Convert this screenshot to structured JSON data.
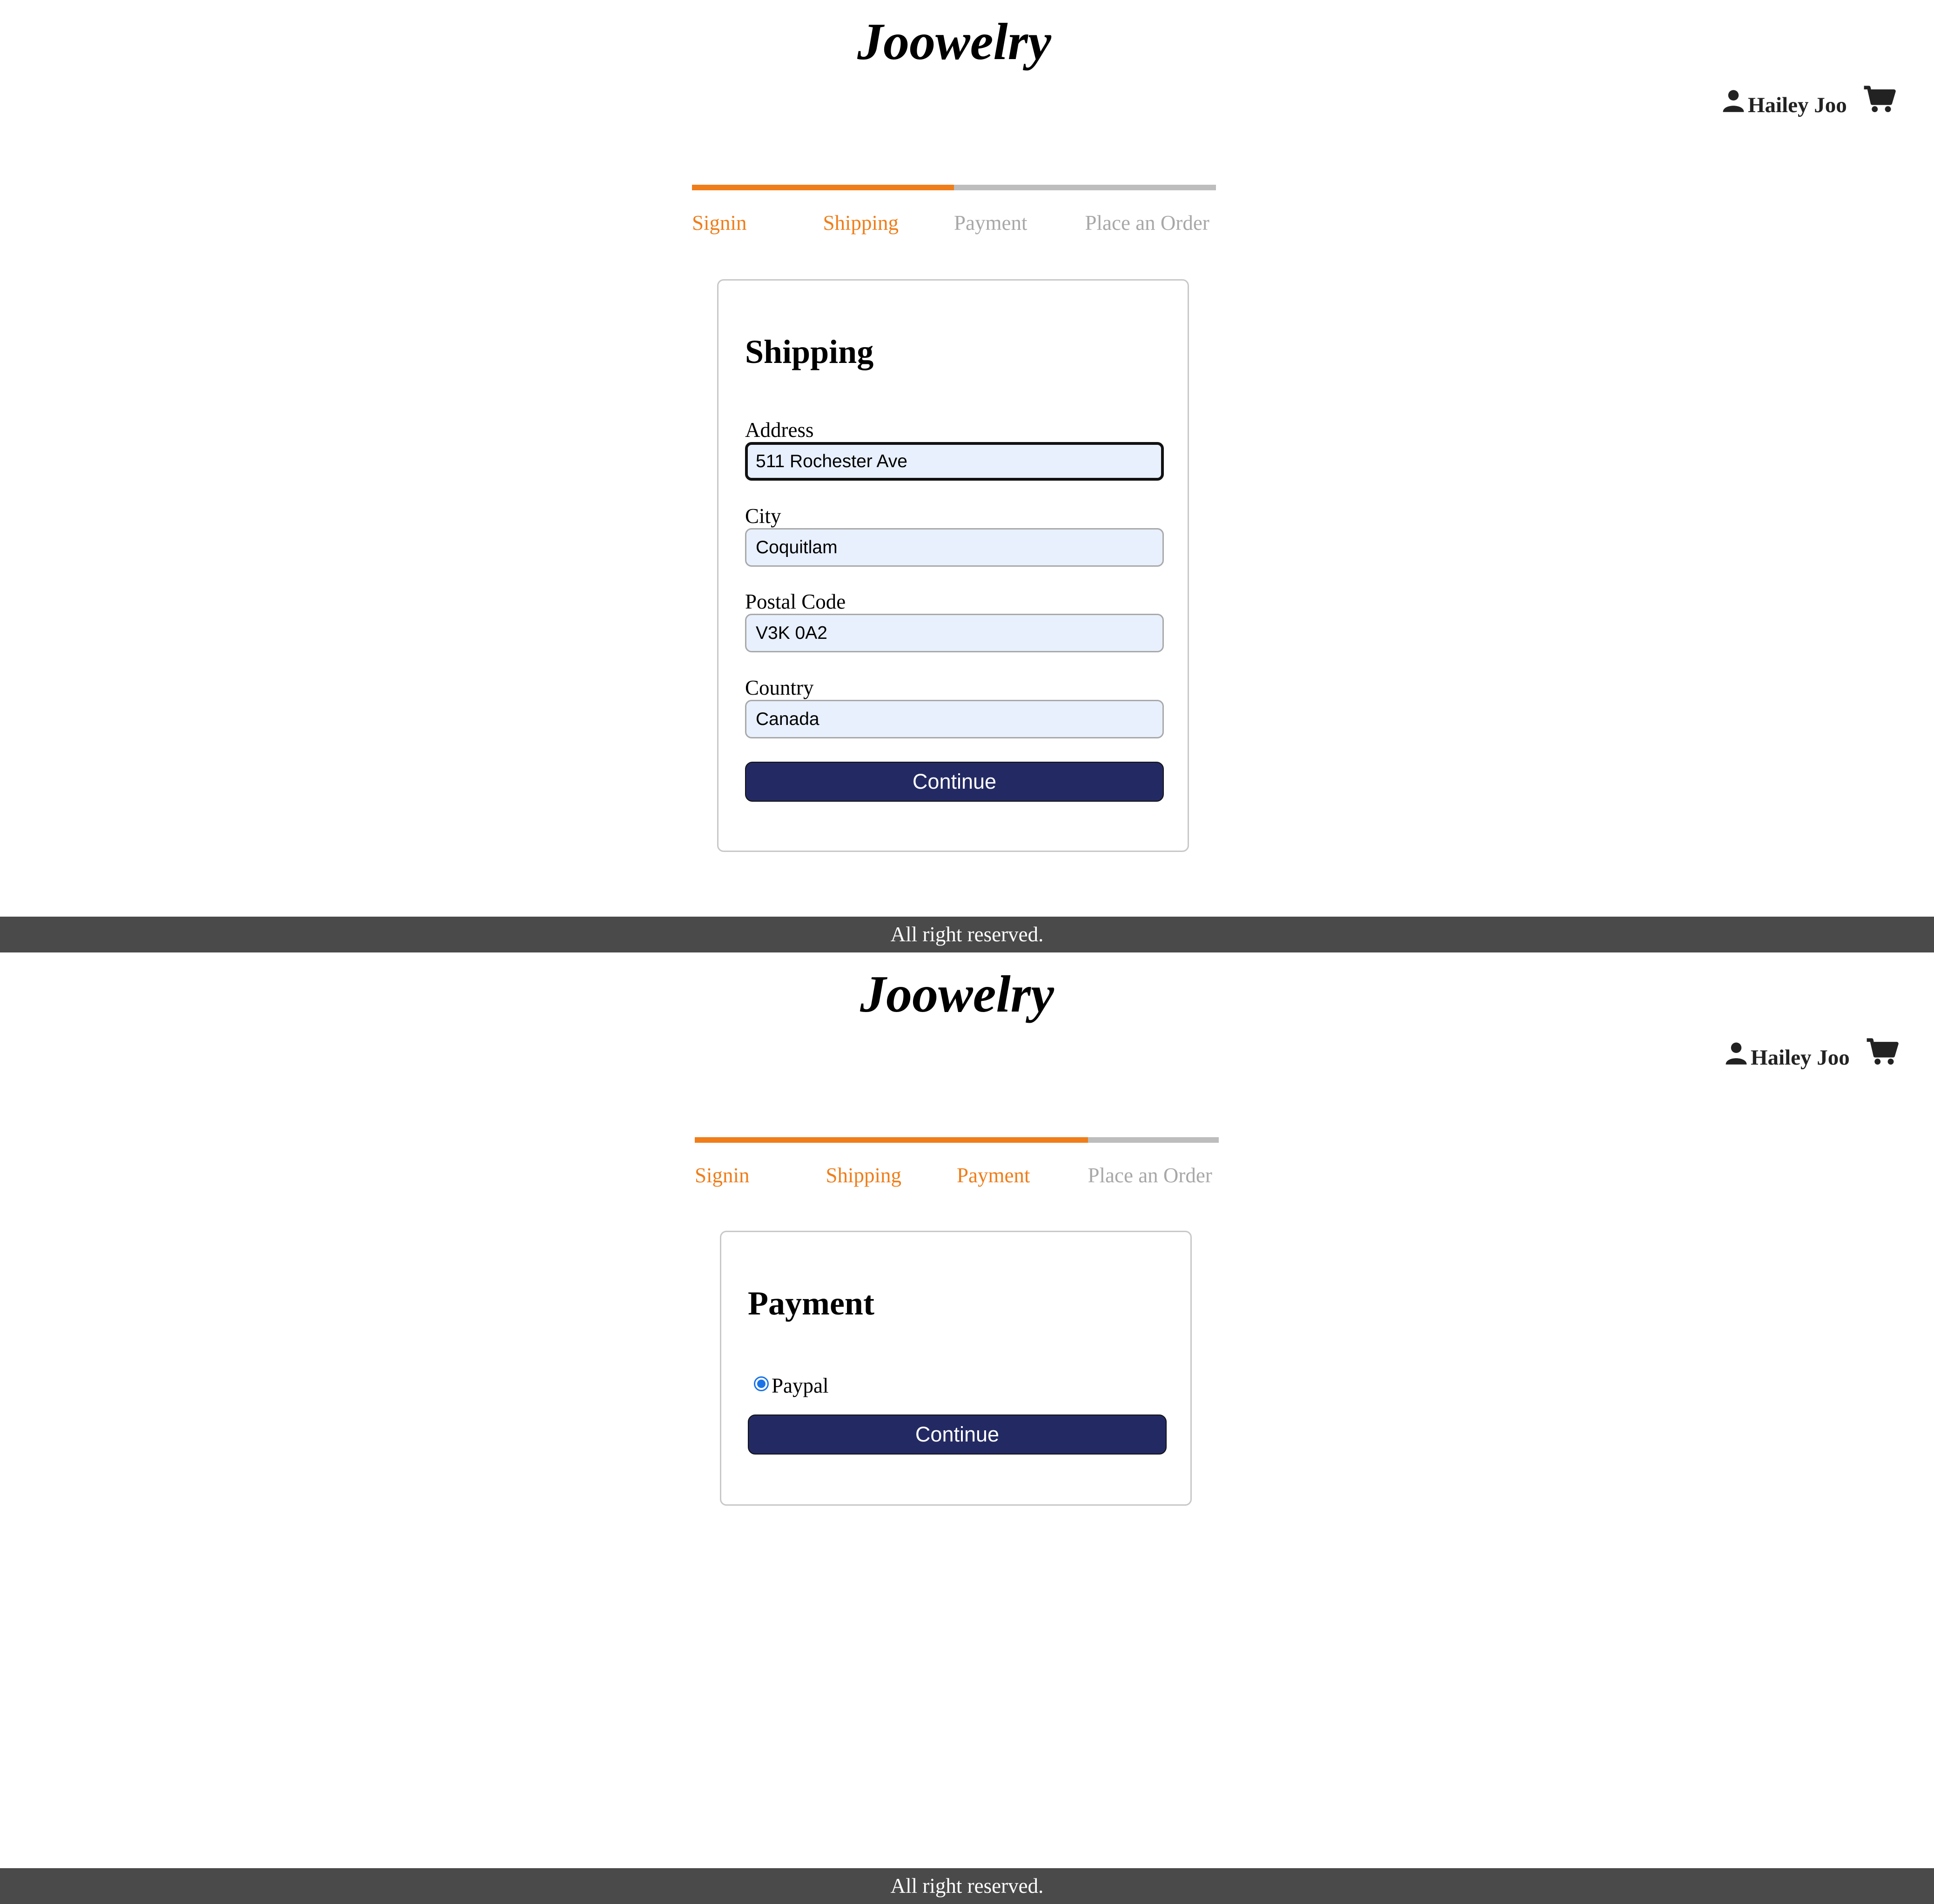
{
  "brand": {
    "logo_text": "Joowelry"
  },
  "user": {
    "name": "Hailey Joo"
  },
  "colors": {
    "accent": "#ef7d1a",
    "inactive": "#a8a8a8",
    "button": "#232a63",
    "footer": "#4a4a4a",
    "input_fill": "#e8f0fe"
  },
  "icons": {
    "user": "user-icon",
    "cart": "cart-icon"
  },
  "checkout_steps": [
    "Signin",
    "Shipping",
    "Payment",
    "Place an Order"
  ],
  "shipping": {
    "title": "Shipping",
    "fields": [
      {
        "label": "Address",
        "value": "511 Rochester Ave"
      },
      {
        "label": "City",
        "value": "Coquitlam"
      },
      {
        "label": "Postal Code",
        "value": "V3K 0A2"
      },
      {
        "label": "Country",
        "value": "Canada"
      }
    ],
    "continue_label": "Continue",
    "progress_completed_steps": 2
  },
  "payment": {
    "title": "Payment",
    "method_label": "Paypal",
    "method_selected": true,
    "continue_label": "Continue",
    "progress_completed_steps": 3
  },
  "footer": {
    "text": "All right reserved."
  }
}
